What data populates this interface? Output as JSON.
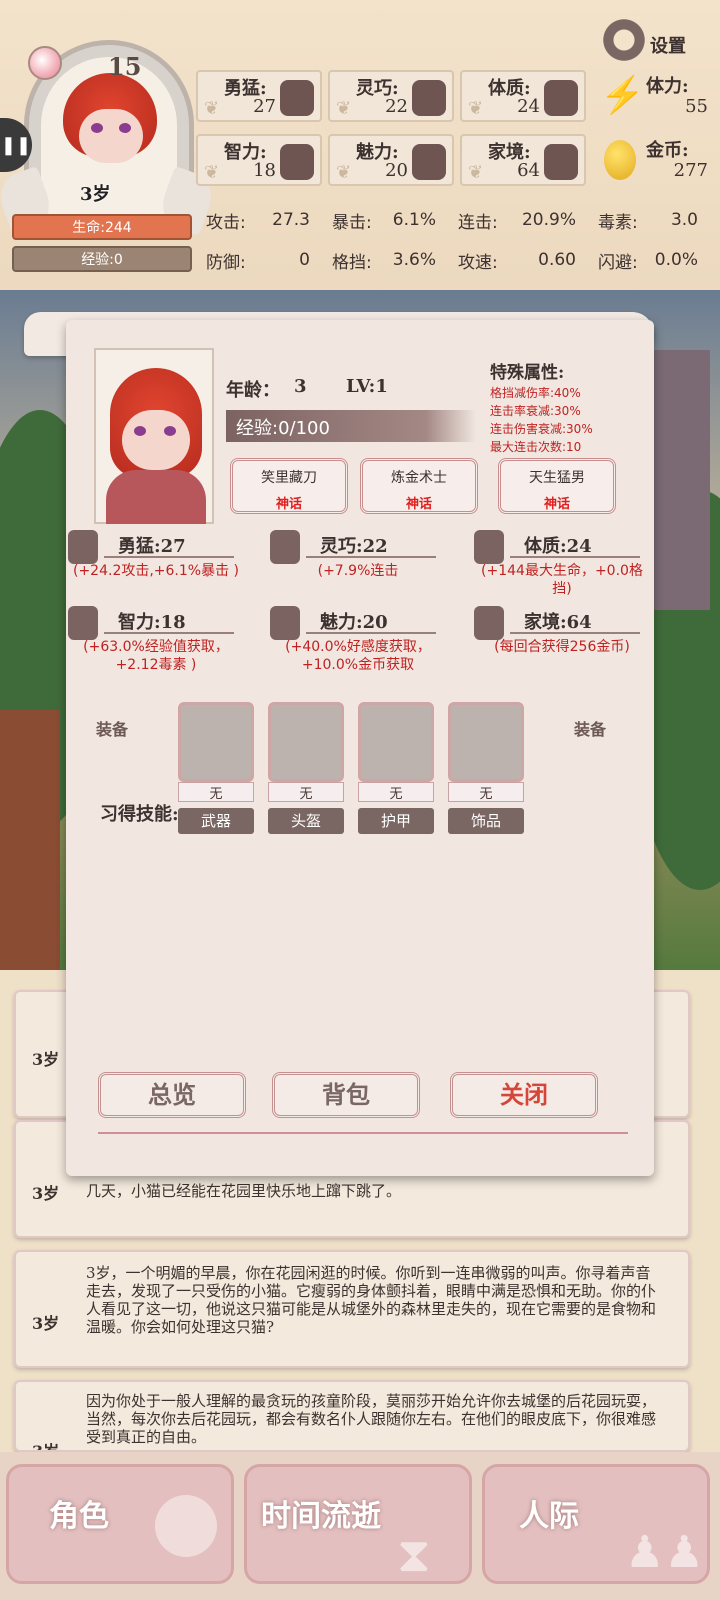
{
  "header": {
    "level": "15",
    "age": "3岁",
    "hp": "生命:244",
    "exp": "经验:0",
    "settings": "设置",
    "side_button": "❚❚",
    "attributes": [
      {
        "label": "勇猛:",
        "value": "27",
        "icon": "fist-icon"
      },
      {
        "label": "灵巧:",
        "value": "22",
        "icon": "cloak-icon"
      },
      {
        "label": "体质:",
        "value": "24",
        "icon": "arm-muscle-icon"
      },
      {
        "label": "智力:",
        "value": "18",
        "icon": "brain-icon"
      },
      {
        "label": "魅力:",
        "value": "20",
        "icon": "flower-bud-icon"
      },
      {
        "label": "家境:",
        "value": "64",
        "icon": "wealth-icon"
      }
    ],
    "resources": [
      {
        "label": "体力:",
        "value": "55",
        "icon": "lightning-icon"
      },
      {
        "label": "金币:",
        "value": "277",
        "icon": "gold-coin-icon"
      }
    ],
    "stats_row1": [
      {
        "label": "攻击:",
        "value": "27.3"
      },
      {
        "label": "暴击:",
        "value": "6.1%"
      },
      {
        "label": "连击:",
        "value": "20.9%"
      },
      {
        "label": "毒素:",
        "value": "3.0"
      }
    ],
    "stats_row2": [
      {
        "label": "防御:",
        "value": "0"
      },
      {
        "label": "格挡:",
        "value": "3.6%"
      },
      {
        "label": "攻速:",
        "value": "0.60"
      },
      {
        "label": "闪避:",
        "value": "0.0%"
      }
    ]
  },
  "modal": {
    "age_label": "年龄：",
    "age_value": "3",
    "lv": "LV:1",
    "exp": "经验:0/100",
    "special_title": "特殊属性:",
    "special_items": [
      "格挡减伤率:40%",
      "连击率衰减:30%",
      "连击伤害衰减:30%",
      "最大连击次数:10"
    ],
    "traits": [
      {
        "name": "笑里藏刀",
        "rarity": "神话"
      },
      {
        "name": "炼金术士",
        "rarity": "神话"
      },
      {
        "name": "天生猛男",
        "rarity": "神话"
      }
    ],
    "attributes": [
      {
        "name": "勇猛:27",
        "bonus": "(+24.2攻击,+6.1%暴击 )"
      },
      {
        "name": "灵巧:22",
        "bonus": "(+7.9%连击"
      },
      {
        "name": "体质:24",
        "bonus": "(+144最大生命，+0.0格挡)"
      },
      {
        "name": "智力:18",
        "bonus": "(+63.0%经验值获取，+2.12毒素 )"
      },
      {
        "name": "魅力:20",
        "bonus": "(+40.0%好感度获取，+10.0%金币获取"
      },
      {
        "name": "家境:64",
        "bonus": "(每回合获得256金币)"
      }
    ],
    "equip_label": "装备",
    "equipment": [
      {
        "name": "武器",
        "state": "无"
      },
      {
        "name": "头盔",
        "state": "无"
      },
      {
        "name": "护甲",
        "state": "无"
      },
      {
        "name": "饰品",
        "state": "无"
      }
    ],
    "skills_label": "习得技能:",
    "buttons": {
      "overview": "总览",
      "bag": "背包",
      "close": "关闭"
    }
  },
  "log": [
    {
      "age": "3岁",
      "text": ""
    },
    {
      "age": "3岁",
      "text": "几天，小猫已经能在花园里快乐地上蹿下跳了。"
    },
    {
      "age": "3岁",
      "text": "3岁，一个明媚的早晨，你在花园闲逛的时候。你听到一连串微弱的叫声。你寻着声音走去，发现了一只受伤的小猫。它瘦弱的身体颤抖着，眼睛中满是恐惧和无助。你的仆人看见了这一切，他说这只猫可能是从城堡外的森林里走失的，现在它需要的是食物和温暖。你会如何处理这只猫?"
    },
    {
      "age": "3岁",
      "text": "因为你处于一般人理解的最贪玩的孩童阶段，莫丽莎开始允许你去城堡的后花园玩耍，当然，每次你去后花园玩，都会有数名仆人跟随你左右。在他们的眼皮底下，你很难感受到真正的自由。"
    }
  ],
  "nav": [
    {
      "label": "角色",
      "icon": "role-icon"
    },
    {
      "label": "时间流逝",
      "icon": "hourglass-icon"
    },
    {
      "label": "人际",
      "icon": "people-icon"
    }
  ]
}
